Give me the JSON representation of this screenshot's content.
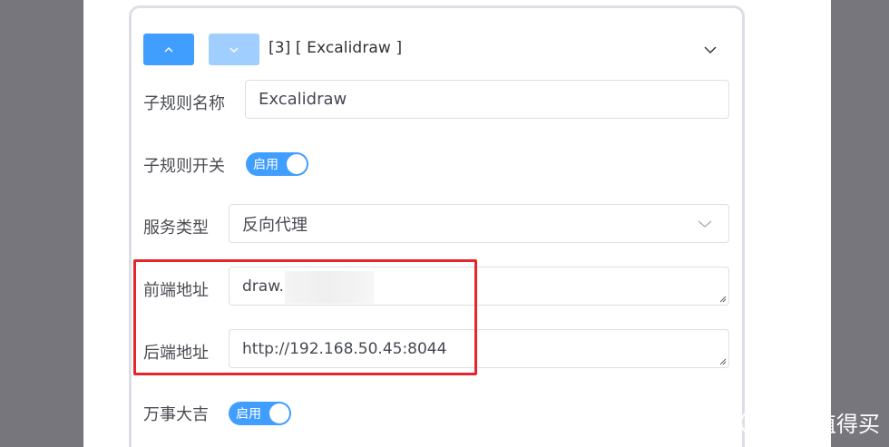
{
  "rule_header": {
    "title": "[3] [ Excalidraw ]"
  },
  "form": {
    "sub_rule_name_label": "子规则名称",
    "sub_rule_name_value": "Excalidraw",
    "sub_rule_switch_label": "子规则开关",
    "sub_rule_switch_text": "启用",
    "service_type_label": "服务类型",
    "service_type_value": "反向代理",
    "frontend_label": "前端地址",
    "frontend_value": "draw.",
    "backend_label": "后端地址",
    "backend_value": "http://192.168.50.45:8044",
    "wanshi_label": "万事大吉",
    "wanshi_switch_text": "启用"
  },
  "watermark": {
    "logo_char": "值",
    "text": "什么值得买"
  },
  "colors": {
    "accent": "#409eff",
    "accent_light": "#a0cfff",
    "highlight": "#e5252b"
  }
}
